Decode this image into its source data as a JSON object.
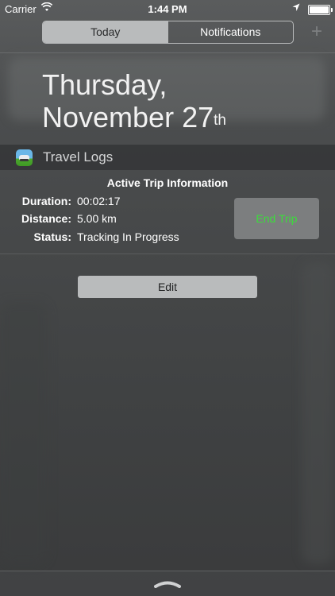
{
  "status_bar": {
    "carrier": "Carrier",
    "time": "1:44 PM"
  },
  "segmented_control": {
    "today_label": "Today",
    "notifications_label": "Notifications"
  },
  "date": {
    "weekday": "Thursday,",
    "month_day": "November 27",
    "suffix": "th"
  },
  "widget": {
    "app_name": "Travel Logs",
    "heading": "Active Trip Information",
    "rows": [
      {
        "label": "Duration:",
        "value": "00:02:17"
      },
      {
        "label": "Distance:",
        "value": "5.00 km"
      },
      {
        "label": "Status:",
        "value": "Tracking In Progress"
      }
    ],
    "end_button_label": "End Trip",
    "end_button_color": "#3cdc3c"
  },
  "edit_label": "Edit",
  "colors": {
    "segment_active": "#b9bbbc",
    "button_bg": "#7c7e7f"
  }
}
